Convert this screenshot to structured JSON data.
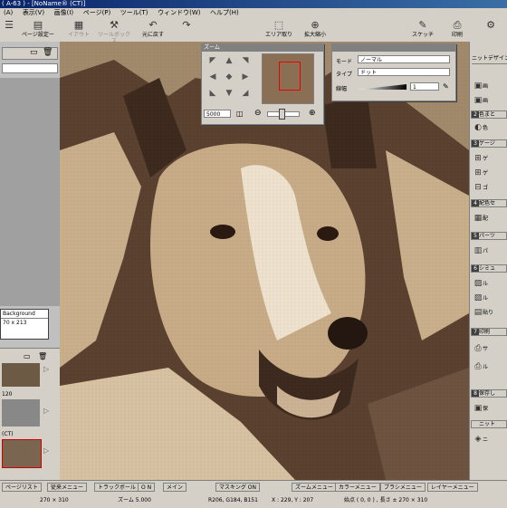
{
  "window": {
    "title": "( A-63 ) - [NoName® (CT)]"
  },
  "menu": [
    "(A)",
    "表示(V)",
    "画像(I)",
    "ページ(P)",
    "ツール(T)",
    "ウィンドウ(W)",
    "ヘルプ(H)"
  ],
  "toolbar": {
    "page_setup": "ページ設定ー",
    "b2": "イアウト",
    "b3": "ツールボックス",
    "back": "元に戻す",
    "area": "エリア取り",
    "zoom": "拡大縮小",
    "sketch": "スケッチ",
    "print": "印刷"
  },
  "zoom_palette": {
    "title": "ズーム",
    "zoom_value": "5000",
    "nav_icons": [
      "arrow-up-left",
      "arrow-up",
      "arrow-up-right",
      "arrow-left",
      "center",
      "arrow-right",
      "arrow-down-left",
      "arrow-down",
      "arrow-down-right"
    ]
  },
  "mode_palette": {
    "mode_label": "モード",
    "mode_value": "ノーマル",
    "type_label": "タイプ",
    "type_value": "ドット",
    "width_label": "線幅",
    "width_value": "1"
  },
  "left": {
    "layer_name": "Background",
    "layer_size": "70 x 213",
    "ruler_label": "120",
    "doc_label": "(CT)"
  },
  "right_panel": {
    "header": "ニットデザイン",
    "sections": [
      {
        "num": "1",
        "label": "",
        "items": [
          "画",
          "画"
        ]
      },
      {
        "num": "2",
        "label": "色まと",
        "items": [
          "色"
        ]
      },
      {
        "num": "3",
        "label": "ゲージ",
        "items": [
          "ゲ",
          "ゲ",
          "ゴ"
        ]
      },
      {
        "num": "4",
        "label": "配色セ",
        "items": [
          "配"
        ]
      },
      {
        "num": "5",
        "label": "パーツ",
        "items": [
          "パ"
        ]
      },
      {
        "num": "6",
        "label": "シミュ",
        "items": [
          "ル",
          "ル",
          "貼り"
        ]
      },
      {
        "num": "7",
        "label": "印刷",
        "items": [
          "サ",
          "ル"
        ]
      },
      {
        "num": "8",
        "label": "保存し",
        "items": [
          "保"
        ]
      },
      {
        "num": "",
        "label": "ニット",
        "items": [
          "ニ"
        ]
      }
    ]
  },
  "status": {
    "page_list": "ページリスト",
    "sync": "従来メニュー",
    "track": "トラックボール",
    "on": "O N",
    "main": "メイン",
    "masking": "マスキング ON",
    "zoom_menu": "ズームメニュー",
    "color_menu": "カラーメニュー",
    "brush_menu": "ブラシメニュー",
    "layer_menu": "レイヤーメニュー",
    "size": "270 × 310",
    "zoom": "ズーム 5.000",
    "rgb": "R206, G184, B151",
    "xy": "X : 229, Y : 207",
    "start": "始点 ( 0, 0 ) , 長さ ± 270 × 310"
  },
  "colors": {
    "light": "#e8d9c2",
    "mid": "#c9ad88",
    "dark": "#4a3424",
    "bg": "#9b846a"
  }
}
